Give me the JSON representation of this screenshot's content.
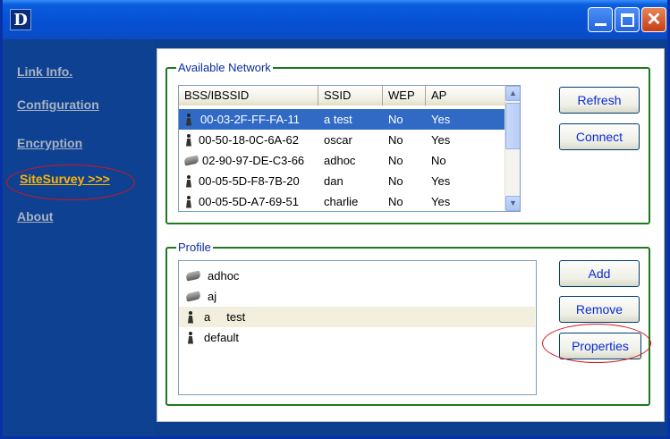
{
  "app": {
    "logo_text": "D",
    "close_glyph": "✕"
  },
  "sidebar": {
    "items": [
      {
        "label": "Link Info."
      },
      {
        "label": "Configuration"
      },
      {
        "label": "Encryption"
      },
      {
        "label": "SiteSurvey >>>",
        "active": true
      },
      {
        "label": "About"
      }
    ]
  },
  "available_network": {
    "title": "Available Network",
    "columns": [
      "BSS/IBSSID",
      "SSID",
      "WEP",
      "AP"
    ],
    "rows": [
      {
        "bssid": "00-03-2F-FF-FA-11",
        "ssid": "a     test",
        "wep": "No",
        "ap": "Yes",
        "icon": "infrastructure-icon",
        "selected": true
      },
      {
        "bssid": "00-50-18-0C-6A-62",
        "ssid": "oscar",
        "wep": "No",
        "ap": "Yes",
        "icon": "infrastructure-icon"
      },
      {
        "bssid": "02-90-97-DE-C3-66",
        "ssid": "adhoc",
        "wep": "No",
        "ap": "No",
        "icon": "adhoc-icon"
      },
      {
        "bssid": "00-05-5D-F8-7B-20",
        "ssid": "dan",
        "wep": "No",
        "ap": "Yes",
        "icon": "infrastructure-icon"
      },
      {
        "bssid": "00-05-5D-A7-69-51",
        "ssid": "charlie",
        "wep": "No",
        "ap": "Yes",
        "icon": "infrastructure-icon"
      }
    ],
    "buttons": {
      "refresh": "Refresh",
      "connect": "Connect"
    },
    "scroll_up_glyph": "▲",
    "scroll_down_glyph": "▼"
  },
  "profile": {
    "title": "Profile",
    "rows": [
      {
        "name": "adhoc",
        "icon": "adhoc-icon"
      },
      {
        "name": "aj",
        "icon": "adhoc-icon"
      },
      {
        "name": "a     test",
        "icon": "infrastructure-icon",
        "selected": true
      },
      {
        "name": "default",
        "icon": "infrastructure-icon"
      }
    ],
    "buttons": {
      "add": "Add",
      "remove": "Remove",
      "properties": "Properties"
    }
  },
  "colors": {
    "accent_highlight": "#d8141a",
    "active_nav": "#ffb400",
    "group_border": "#1c7a1c"
  }
}
